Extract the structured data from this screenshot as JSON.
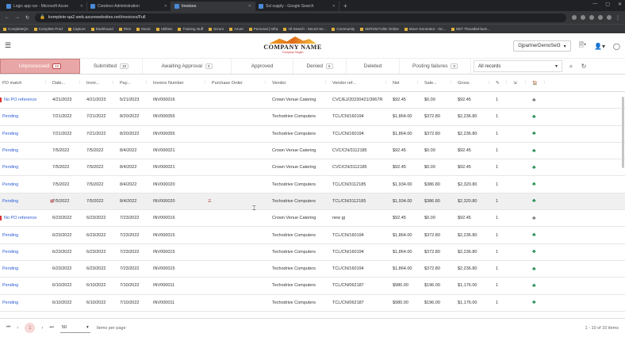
{
  "browser": {
    "tabs": [
      {
        "label": "Logic app run - Microsoft Azure"
      },
      {
        "label": "Condeco Administration"
      },
      {
        "label": "Invoices",
        "active": true
      },
      {
        "label": "Ssl supply - Google Search"
      }
    ],
    "url": "komplete-qa2.web.azurewebsites.net/invoices/Full",
    "bookmarks": [
      "CompleteQA",
      "Complete Prod",
      "Capture",
      "Dashboard",
      "RSS",
      "Music",
      "Utilities",
      "Training stuff",
      "Scrum",
      "Azure",
      "Personal | Infra",
      "All Search - Secret Se...",
      "Community",
      "SERVM Fuller Online",
      "Move Generator - Inc...",
      "NET Thrustbel-bum..."
    ]
  },
  "header": {
    "company_name": "COMPANY NAME",
    "slogan": "Company Slogan",
    "partner": "GjpartnerDemoSet3"
  },
  "status_tabs": [
    {
      "label": "Unprocessed",
      "count": "55",
      "active": true
    },
    {
      "label": "Submitted",
      "count": "10"
    },
    {
      "label": "Awaiting Approval",
      "count": "0"
    },
    {
      "label": "Approved",
      "count": ""
    },
    {
      "label": "Denied",
      "count": "6"
    },
    {
      "label": "Deleted",
      "count": ""
    },
    {
      "label": "Posting failures",
      "count": "0"
    }
  ],
  "records_filter": "All records",
  "columns": [
    "PO match",
    "Date...",
    "Invoi...",
    "Pay...",
    "Invoice Number",
    "Purchase Order",
    "Vendor",
    "Vendor ref...",
    "Net",
    "Sale...",
    "Gross",
    "",
    "",
    "",
    ""
  ],
  "rows": [
    [
      "No PO reference",
      "4/21/2023",
      "4/21/2023",
      "5/21/2023",
      "INV000016",
      "",
      "Crown Venue Catering",
      "CVC/EJ/20230421/3967R",
      "$92.45",
      "$0.00",
      "$92.45",
      "1",
      "gray"
    ],
    [
      "Pending",
      "7/21/2022",
      "7/21/2022",
      "8/20/2022",
      "INV000055",
      "",
      "Techodrive Computers",
      "TCL/CN/160194",
      "$1,864.00",
      "$372.80",
      "$2,236.80",
      "1",
      "green"
    ],
    [
      "Pending",
      "7/21/2022",
      "7/21/2022",
      "8/20/2022",
      "INV000055",
      "",
      "Techodrive Computers",
      "TCL/CN/160194",
      "$1,864.00",
      "$372.80",
      "$2,236.80",
      "1",
      "green"
    ],
    [
      "Pending",
      "7/5/2022",
      "7/5/2022",
      "8/4/2022",
      "INV000021",
      "",
      "Crown Venue Catering",
      "CVC/CN/3112185",
      "$92.45",
      "$0.00",
      "$92.45",
      "1",
      "green"
    ],
    [
      "Pending",
      "7/5/2022",
      "7/5/2022",
      "8/4/2022",
      "INV000021",
      "",
      "Crown Venue Catering",
      "CVC/CN/3112185",
      "$92.45",
      "$0.00",
      "$92.45",
      "1",
      "green"
    ],
    [
      "Pending",
      "7/5/2022",
      "7/5/2022",
      "8/4/2022",
      "INV000020",
      "",
      "Techodrive Computers",
      "TCL/CN/3112185",
      "$1,934.00",
      "$386.80",
      "$2,320.80",
      "1",
      "green"
    ],
    [
      "Pending",
      "7/5/2022",
      "7/5/2022",
      "8/4/2022",
      "INV000020",
      "",
      "Techodrive Computers",
      "TCL/CN/3112185",
      "$1,934.00",
      "$386.80",
      "$2,320.80",
      "1",
      "green"
    ],
    [
      "No PO reference",
      "6/23/2022",
      "6/23/2022",
      "7/23/2022",
      "INV000016",
      "",
      "Crown Venue Catering",
      "new gj",
      "$92.45",
      "$0.00",
      "$92.45",
      "1",
      "gray"
    ],
    [
      "Pending",
      "6/23/2022",
      "6/23/2022",
      "7/23/2022",
      "INV000015",
      "",
      "Techodrive Computers",
      "TCL/CN/160194",
      "$1,864.00",
      "$372.80",
      "$2,236.80",
      "1",
      "green"
    ],
    [
      "Pending",
      "6/23/2022",
      "6/23/2022",
      "7/23/2022",
      "INV000015",
      "",
      "Techodrive Computers",
      "TCL/CN/160194",
      "$1,864.00",
      "$372.80",
      "$2,236.80",
      "1",
      "green"
    ],
    [
      "Pending",
      "6/23/2022",
      "6/23/2022",
      "7/23/2022",
      "INV000015",
      "",
      "Techodrive Computers",
      "TCL/CN/160194",
      "$1,864.00",
      "$372.80",
      "$2,236.80",
      "1",
      "green"
    ],
    [
      "Pending",
      "6/10/2022",
      "6/10/2022",
      "7/10/2022",
      "INV000011",
      "",
      "Techodrive Computers",
      "TCL/CN/062187",
      "$980.00",
      "$196.00",
      "$1,176.00",
      "1",
      "green"
    ],
    [
      "Pending",
      "6/10/2022",
      "6/10/2022",
      "7/10/2022",
      "INV000011",
      "",
      "Techodrive Computers",
      "TCL/CN/062187",
      "$980.00",
      "$196.00",
      "$1,176.00",
      "1",
      "green"
    ]
  ],
  "footer": {
    "current_page": "1",
    "per_page": "50",
    "per_page_label": "Items per page",
    "range": "1 - 10 of 10 items"
  }
}
